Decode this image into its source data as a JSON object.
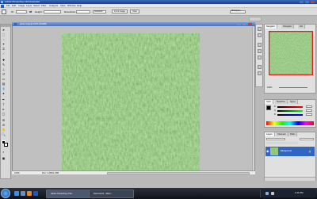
{
  "window": {
    "title": "Adobe Photoshop CS3 Extended"
  },
  "menu": [
    "File",
    "Edit",
    "Image",
    "Layer",
    "Select",
    "Filter",
    "Analysis",
    "View",
    "Window",
    "Help"
  ],
  "options": {
    "width_label": "W:",
    "width_value": "Width",
    "height_label": "Height:",
    "resolution_label": "Resolution:",
    "resolution_unit": "pixels/inch",
    "front_image_label": "Front Image",
    "clear_label": "Clear",
    "workspace_label": "Workspace"
  },
  "document": {
    "title": "grass-4.jpg @ 100% (RGB/8)",
    "zoom": "100%",
    "doc_info": "Doc: 1.25M/1.25M"
  },
  "navigator": {
    "tabs": [
      "Navigator",
      "Histogram",
      "Info"
    ],
    "zoom": "100%"
  },
  "color": {
    "tabs": [
      "Color",
      "Swatches",
      "Styles"
    ],
    "channels": [
      "R",
      "G",
      "B"
    ]
  },
  "layers": {
    "tabs": [
      "Layers",
      "Channels",
      "Paths"
    ],
    "layer_name": "Background"
  },
  "taskbar": {
    "items": [
      "Adobe Photoshop CS3...",
      "Document1 - Micro..."
    ],
    "clock": "1:31 PM"
  }
}
